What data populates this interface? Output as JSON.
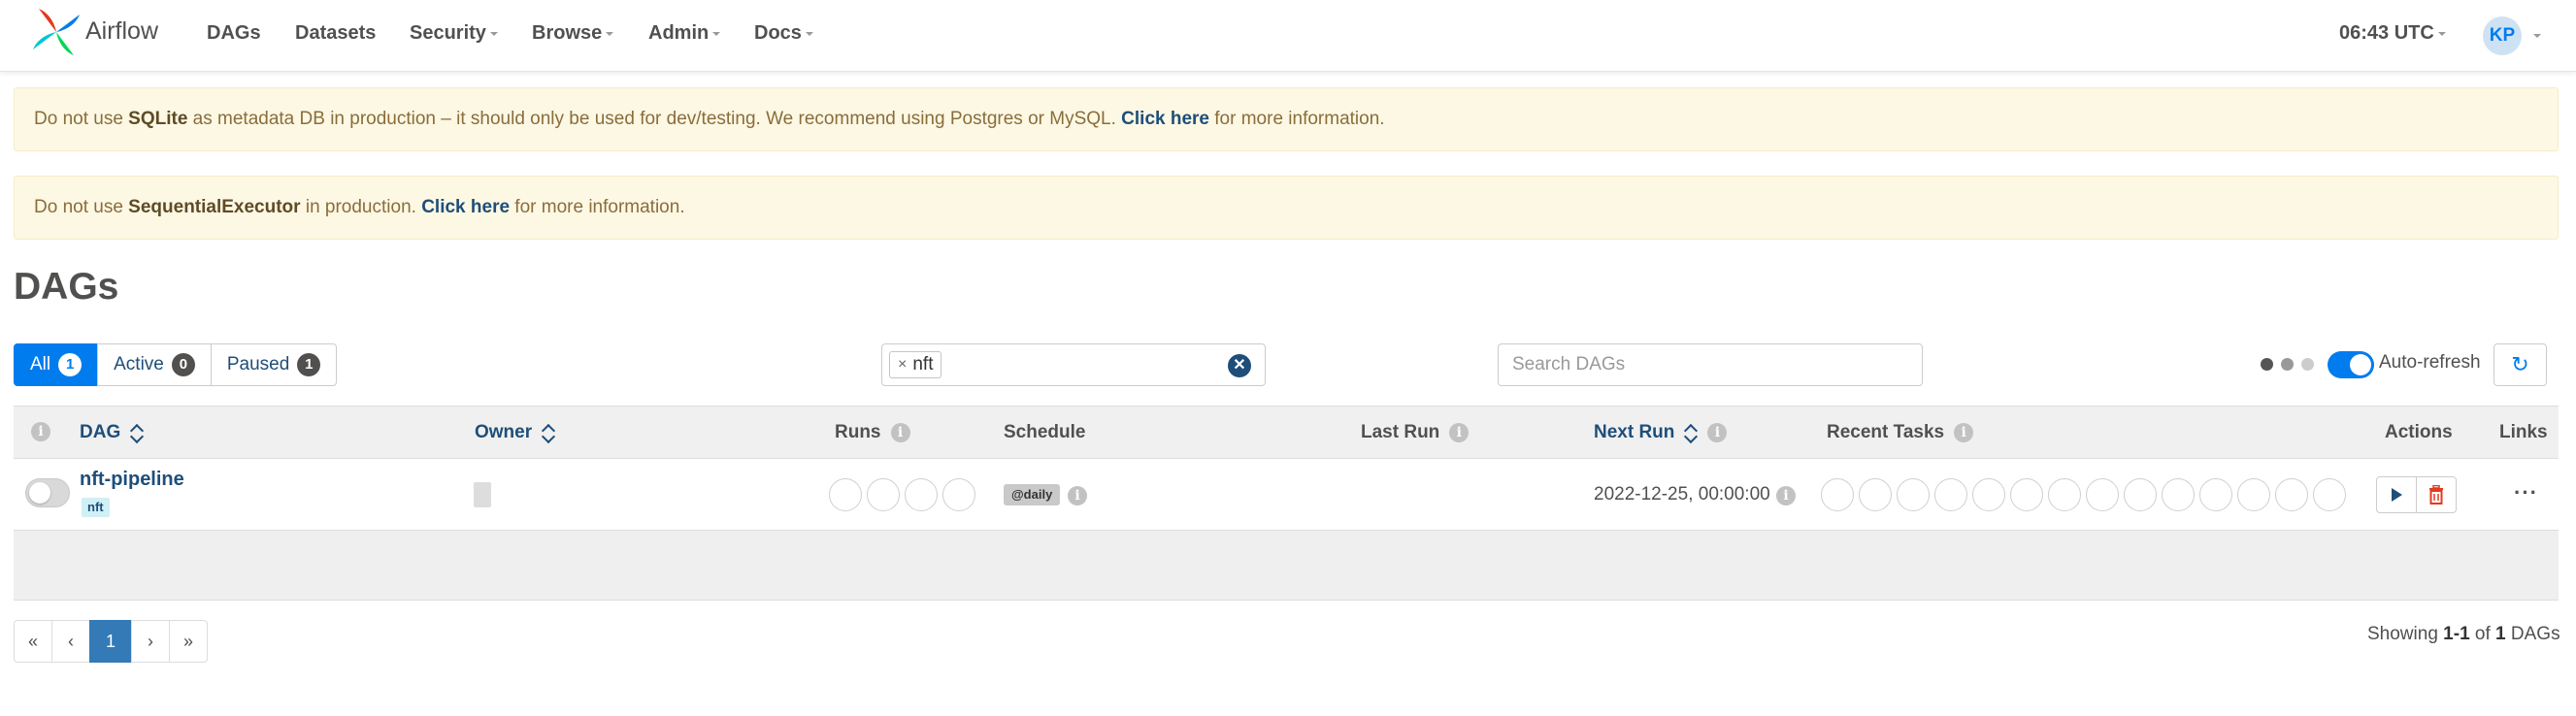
{
  "nav": {
    "brand": "Airflow",
    "items": [
      {
        "label": "DAGs",
        "dropdown": false
      },
      {
        "label": "Datasets",
        "dropdown": false
      },
      {
        "label": "Security",
        "dropdown": true
      },
      {
        "label": "Browse",
        "dropdown": true
      },
      {
        "label": "Admin",
        "dropdown": true
      },
      {
        "label": "Docs",
        "dropdown": true
      }
    ],
    "clock": "06:43 UTC",
    "user_initials": "KP"
  },
  "alerts": [
    {
      "prefix": "Do not use ",
      "bold": "SQLite",
      "middle": " as metadata DB in production – it should only be used for dev/testing. We recommend using Postgres or MySQL. ",
      "link": "Click here",
      "suffix": " for more information."
    },
    {
      "prefix": "Do not use ",
      "bold": "SequentialExecutor",
      "middle": " in production. ",
      "link": "Click here",
      "suffix": " for more information."
    }
  ],
  "page_title": "DAGs",
  "status_filter": [
    {
      "label": "All",
      "count": "1",
      "active": true
    },
    {
      "label": "Active",
      "count": "0",
      "active": false
    },
    {
      "label": "Paused",
      "count": "1",
      "active": false
    }
  ],
  "tag_filter": {
    "tag": "nft",
    "remove_glyph": "×",
    "clear_glyph": "✕"
  },
  "search": {
    "placeholder": "Search DAGs",
    "value": ""
  },
  "auto_refresh": {
    "label": "Auto-refresh",
    "enabled": true,
    "refresh_glyph": "↻"
  },
  "table": {
    "headers": {
      "dag": "DAG",
      "owner": "Owner",
      "runs": "Runs",
      "schedule": "Schedule",
      "last_run": "Last Run",
      "next_run": "Next Run",
      "recent_tasks": "Recent Tasks",
      "actions": "Actions",
      "links": "Links"
    },
    "rows": [
      {
        "dag_id": "nft-pipeline",
        "tag": "nft",
        "paused": true,
        "owner": "",
        "run_circles": 4,
        "schedule": "@daily",
        "last_run": "",
        "next_run": "2022-12-25, 00:00:00",
        "task_circles": 14,
        "links_glyph": "···"
      }
    ]
  },
  "pagination": {
    "first": "«",
    "prev": "‹",
    "current": "1",
    "next": "›",
    "last": "»"
  },
  "showing": {
    "prefix": "Showing ",
    "range": "1-1",
    "of": " of ",
    "total": "1",
    "suffix": " DAGs"
  },
  "colors": {
    "brand_blue": "#017cee",
    "link_blue": "#1e4e79",
    "alert_bg": "#fdf8e4",
    "delete_red": "#e43921"
  }
}
